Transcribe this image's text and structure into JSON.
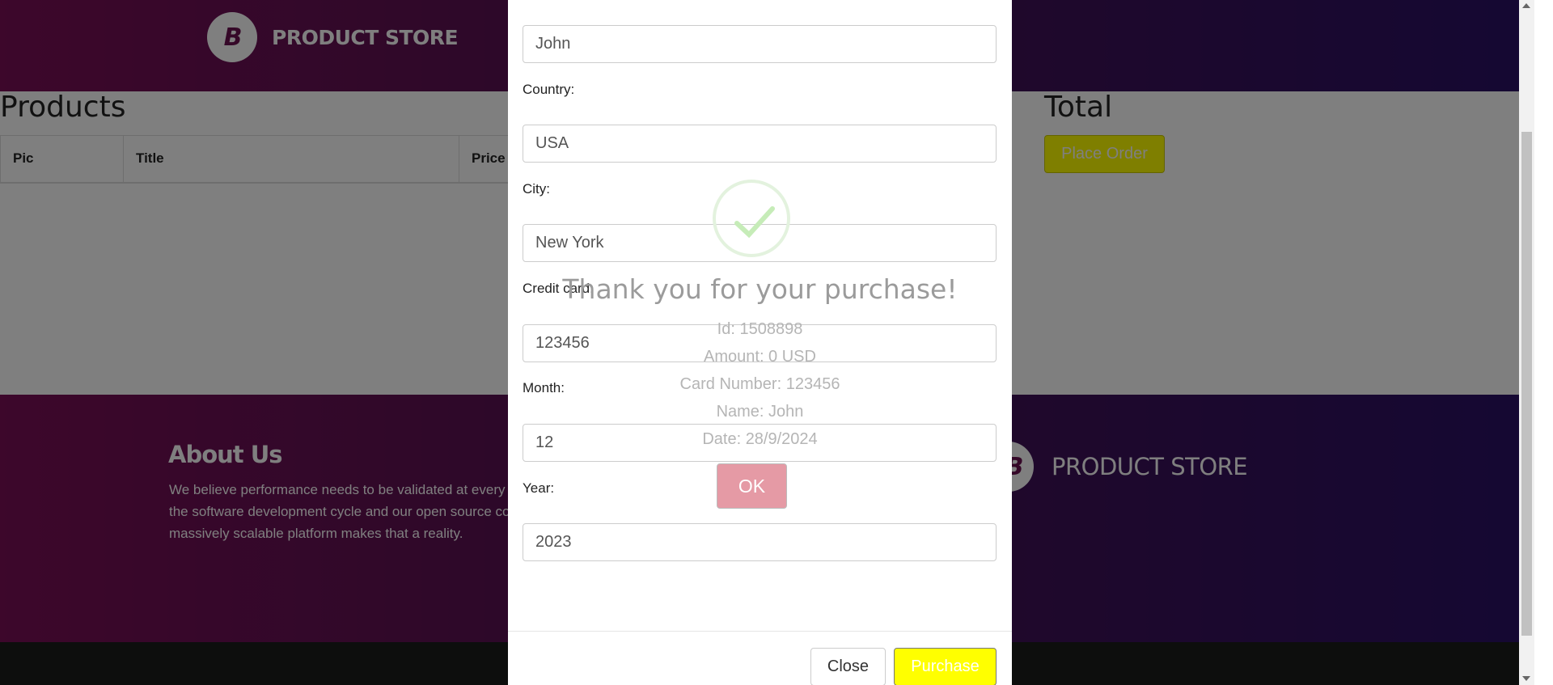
{
  "navbar": {
    "brand_logo": "B",
    "brand_name": "PRODUCT STORE"
  },
  "cart": {
    "products_heading": "Products",
    "columns": [
      "Pic",
      "Title",
      "Price"
    ],
    "total_heading": "Total",
    "place_order_label": "Place Order"
  },
  "footer": {
    "about_title": "About Us",
    "about_text": "We believe performance needs to be validated at every stage of the software development cycle and our open source compatible, massively scalable platform makes that a reality.",
    "brand_name": "PRODUCT STORE"
  },
  "order_form": {
    "name_value": "John",
    "country_label": "Country:",
    "country_value": "USA",
    "city_label": "City:",
    "city_value": "New York",
    "card_label": "Credit card:",
    "card_value": "123456",
    "month_label": "Month:",
    "month_value": "12",
    "year_label": "Year:",
    "year_value": "2023",
    "close_label": "Close",
    "purchase_label": "Purchase"
  },
  "confirmation": {
    "icon": "checkmark-icon",
    "title": "Thank you for your purchase!",
    "id_line": "Id: 1508898",
    "amount_line": "Amount: 0 USD",
    "card_line": "Card Number: 123456",
    "name_line": "Name: John",
    "date_line": "Date: 28/9/2024",
    "ok_label": "OK"
  },
  "colors": {
    "brand_gradient_start": "#7a0e56",
    "brand_gradient_end": "#2a1065",
    "accent_yellow": "#ffff00",
    "ok_button": "#e59aa5",
    "check_green": "#a5dc86"
  }
}
